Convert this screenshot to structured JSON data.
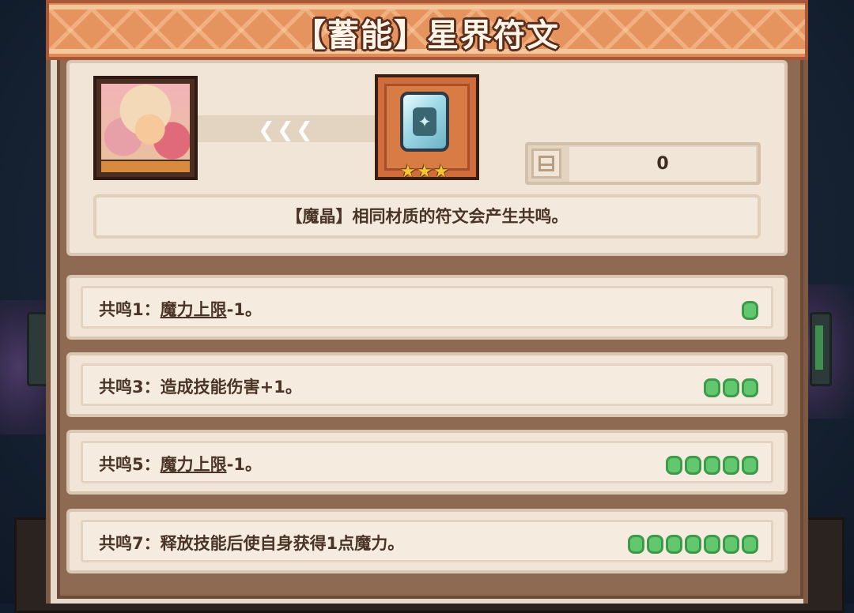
{
  "title": "【蓄能】星界符文",
  "rune": {
    "stars": 3,
    "owned_count": "0",
    "description": "【魔晶】相同材质的符文会产生共鸣。"
  },
  "resonances": [
    {
      "prefix": "共鸣1：",
      "keyword": "魔力上限",
      "suffix": "-1。",
      "required": 1
    },
    {
      "prefix": "共鸣3：",
      "keyword": "",
      "suffix": "造成技能伤害+1。",
      "required": 3
    },
    {
      "prefix": "共鸣5：",
      "keyword": "魔力上限",
      "suffix": "-1。",
      "required": 5
    },
    {
      "prefix": "共鸣7：",
      "keyword": "",
      "suffix": "释放技能后使自身获得1点魔力。",
      "required": 7
    }
  ],
  "icons": {
    "portrait": "character-portrait",
    "rune": "crystal-rune-icon",
    "star": "star-icon",
    "count": "inventory-icon",
    "arrow": "chevron-left-icon",
    "resonance_dot": "resonance-pip-icon"
  },
  "colors": {
    "title_bar": "#e08a5a",
    "panel": "#e8dacb",
    "pip_green": "#62c86e",
    "star_gold": "#f5c533"
  }
}
